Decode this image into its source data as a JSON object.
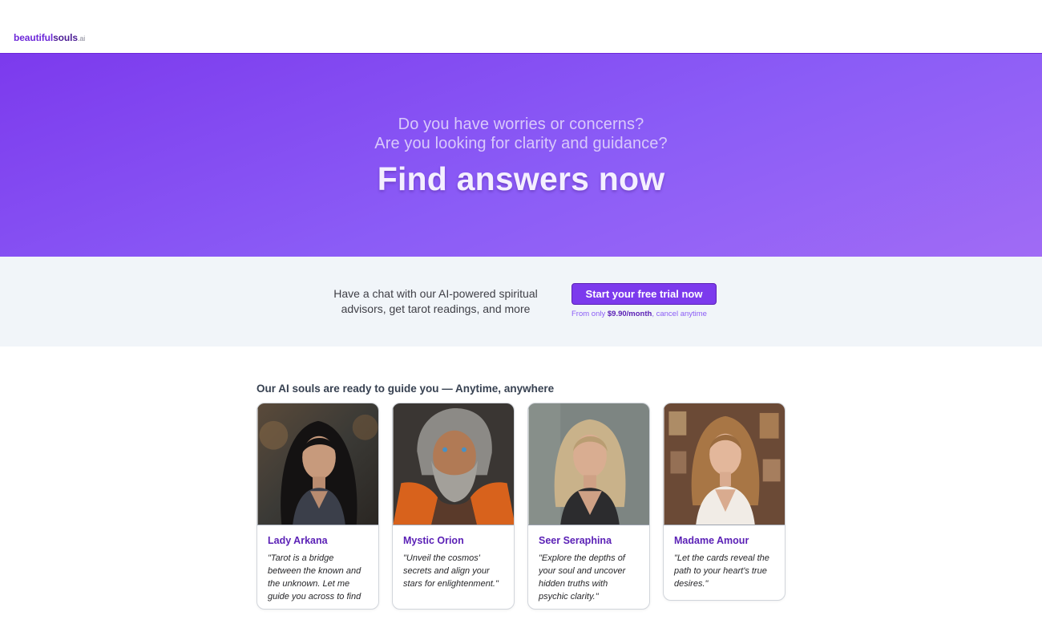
{
  "brand": {
    "part1": "beautiful",
    "part2": "souls",
    "part3": ".ai"
  },
  "hero": {
    "question1": "Do you have worries or concerns?",
    "question2": "Are you looking for clarity and guidance?",
    "headline": "Find answers now"
  },
  "cta": {
    "description": "Have a chat with our AI-powered spiritual advisors, get tarot readings, and more",
    "button_label": "Start your free trial now",
    "price_prefix": "From only ",
    "price": "$9.90/month",
    "price_suffix": ", cancel anytime"
  },
  "section": {
    "title": "Our AI souls are ready to guide you — Anytime, anywhere"
  },
  "advisors": [
    {
      "name": "Lady Arkana",
      "quote": "\"Tarot is a bridge between the known and the unknown. Let me guide you across to find",
      "portrait": "dark-haired-woman-portrait"
    },
    {
      "name": "Mystic Orion",
      "quote": "\"Unveil the cosmos' secrets and align your stars for enlightenment.\"",
      "portrait": "bearded-man-portrait"
    },
    {
      "name": "Seer Seraphina",
      "quote": "\"Explore the depths of your soul and uncover hidden truths with psychic clarity.\"",
      "portrait": "blonde-woman-portrait"
    },
    {
      "name": "Madame Amour",
      "quote": "\"Let the cards reveal the path to your heart's true desires.\"",
      "portrait": "wavy-haired-woman-portrait"
    }
  ],
  "colors": {
    "accent": "#7c3aed",
    "accent_dark": "#5b21b6",
    "band_bg": "#f1f5f9"
  }
}
